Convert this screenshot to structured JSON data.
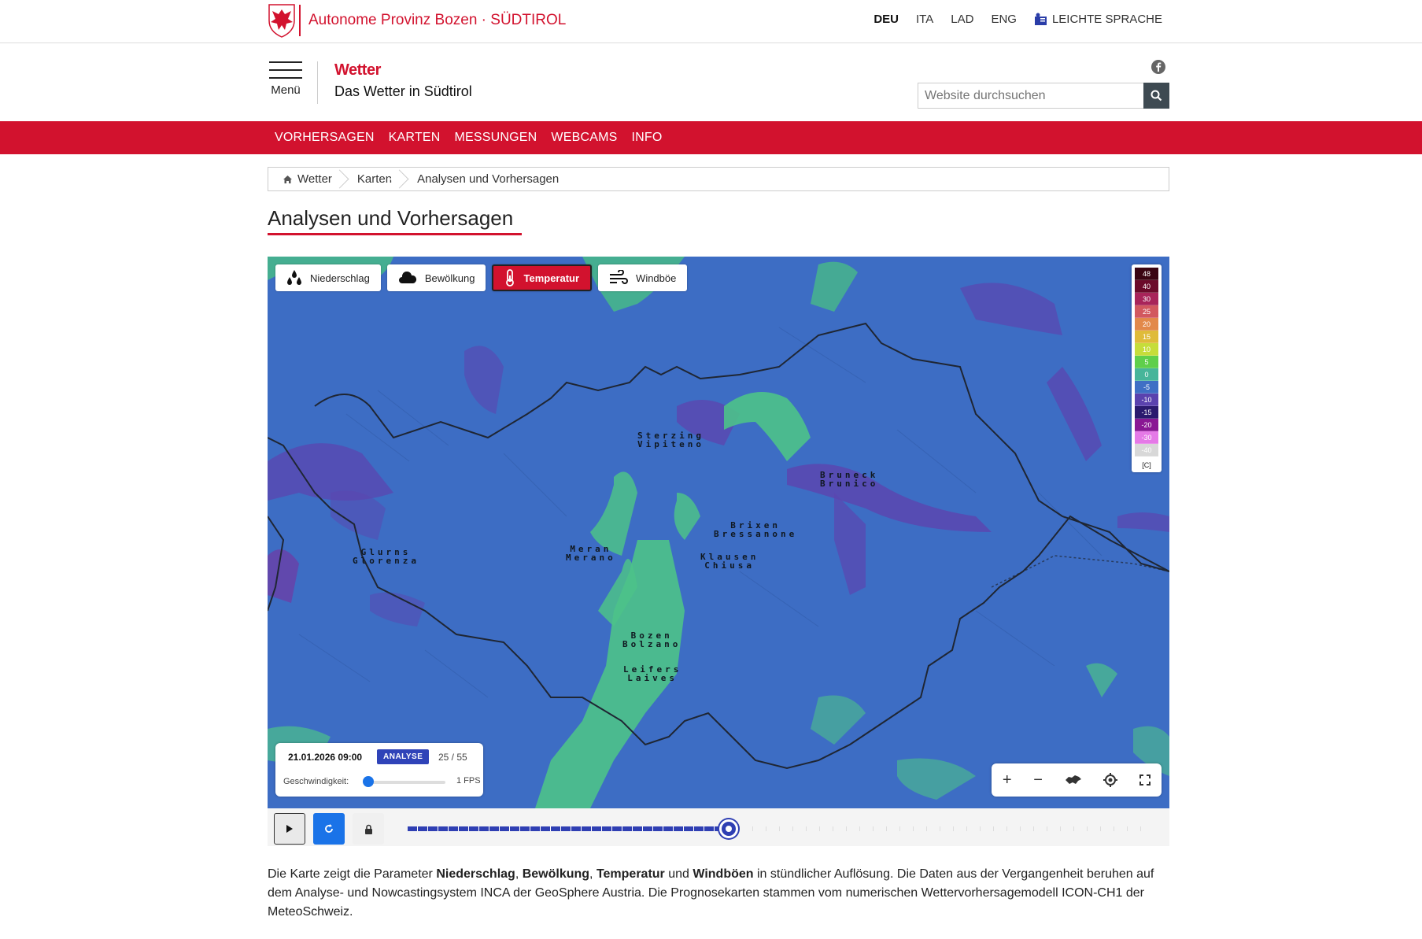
{
  "topbar": {
    "brand": "Autonome Provinz Bozen · SÜDTIROL",
    "languages": [
      "DEU",
      "ITA",
      "LAD",
      "ENG"
    ],
    "active_language": "DEU",
    "easy_language": "LEICHTE SPRACHE"
  },
  "header": {
    "menu_label": "Menü",
    "title": "Wetter",
    "subtitle": "Das Wetter in Südtirol",
    "search_placeholder": "Website durchsuchen"
  },
  "nav": {
    "items": [
      "VORHERSAGEN",
      "KARTEN",
      "MESSUNGEN",
      "WEBCAMS",
      "INFO"
    ]
  },
  "breadcrumb": [
    "Wetter",
    "Karten",
    "Analysen und Vorhersagen"
  ],
  "page_title": "Analysen und Vorhersagen",
  "map": {
    "layers": [
      "Niederschlag",
      "Bewölkung",
      "Temperatur",
      "Windböe"
    ],
    "active_layer": "Temperatur",
    "legend": {
      "values": [
        "48",
        "40",
        "30",
        "25",
        "20",
        "15",
        "10",
        "5",
        "0",
        "-5",
        "-10",
        "-15",
        "-20",
        "-30",
        "-40"
      ],
      "colors": [
        "#3a0512",
        "#6b0a2a",
        "#a8245a",
        "#d2585f",
        "#e2894a",
        "#dfbb3a",
        "#c6dd3a",
        "#5fcf4b",
        "#47b59a",
        "#3f6fc5",
        "#5a42ae",
        "#2a1a6e",
        "#8a1794",
        "#e57ae7",
        "#d8d8d8"
      ],
      "unit": "[C]"
    },
    "places": [
      {
        "name": "Sterzing",
        "alt": "Vipiteno"
      },
      {
        "name": "Bruneck",
        "alt": "Brunico"
      },
      {
        "name": "Brixen",
        "alt": "Bressanone"
      },
      {
        "name": "Glurns",
        "alt": "Glorenza"
      },
      {
        "name": "Meran",
        "alt": "Merano"
      },
      {
        "name": "Klausen",
        "alt": "Chiusa"
      },
      {
        "name": "Bozen",
        "alt": "Bolzano"
      },
      {
        "name": "Leifers",
        "alt": "Laives"
      }
    ],
    "info": {
      "datetime": "21.01.2026 09:00",
      "badge": "ANALYSE",
      "frame": "25 / 55",
      "speed_label": "Geschwindigkeit:",
      "fps": "1 FPS"
    },
    "controls": [
      "+",
      "−"
    ]
  },
  "player": {
    "progress": 0.436
  },
  "description": {
    "p1": "Die Karte zeigt die Parameter ",
    "b1": "Niederschlag",
    "s1": ", ",
    "b2": "Bewölkung",
    "s2": ", ",
    "b3": "Temperatur",
    "s3": " und ",
    "b4": "Windböen",
    "p2": " in stündlicher Auflösung. Die Daten aus der Vergangenheit beruhen auf dem Analyse- und Nowcastingsystem INCA der GeoSphere Austria. Die Prognosekarten stammen vom numerischen Wettervorhersagemodell ICON-CH1 der MeteoSchweiz."
  }
}
